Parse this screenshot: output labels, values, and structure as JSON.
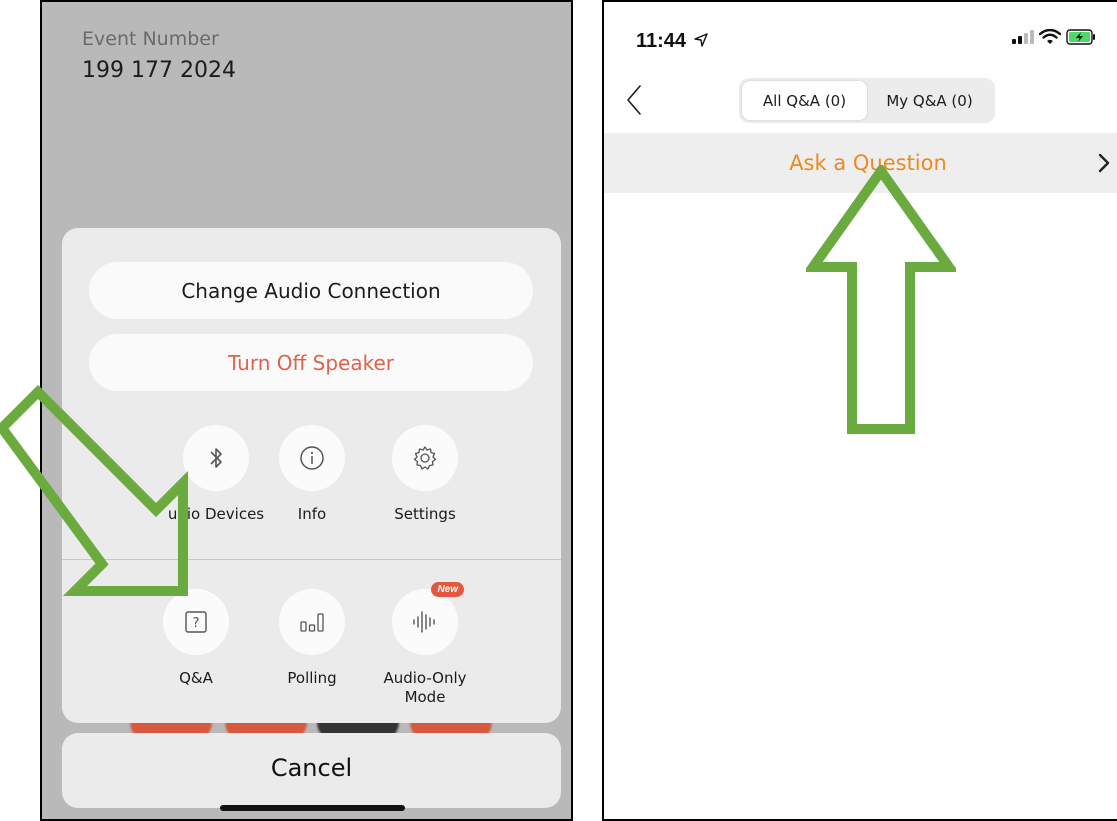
{
  "left_screen": {
    "event_label": "Event Number",
    "event_number": "199 177 2024",
    "buttons": {
      "change_audio": "Change Audio Connection",
      "turn_off_speaker": "Turn Off Speaker",
      "cancel": "Cancel"
    },
    "options_row1": [
      {
        "label": "Audio Devices",
        "visible_label": "udio Devices",
        "icon": "bluetooth-icon"
      },
      {
        "label": "Info",
        "icon": "info-icon"
      },
      {
        "label": "Settings",
        "icon": "gear-icon"
      }
    ],
    "options_row2": [
      {
        "label": "Q&A",
        "icon": "question-icon"
      },
      {
        "label": "Polling",
        "icon": "bar-chart-icon"
      },
      {
        "label": "Audio-Only\nMode",
        "label_line1": "Audio-Only",
        "label_line2": "Mode",
        "icon": "waveform-icon",
        "badge": "New"
      }
    ]
  },
  "right_screen": {
    "time": "11:44",
    "tabs": [
      {
        "label": "All Q&A (0)",
        "active": true
      },
      {
        "label": "My Q&A (0)",
        "active": false
      }
    ],
    "ask_question": "Ask a Question"
  },
  "colors": {
    "annotation_arrow": "#6aaa3f",
    "accent_orange": "#ec8a1b",
    "speaker_red": "#e0624a",
    "badge_red": "#e4563d"
  }
}
